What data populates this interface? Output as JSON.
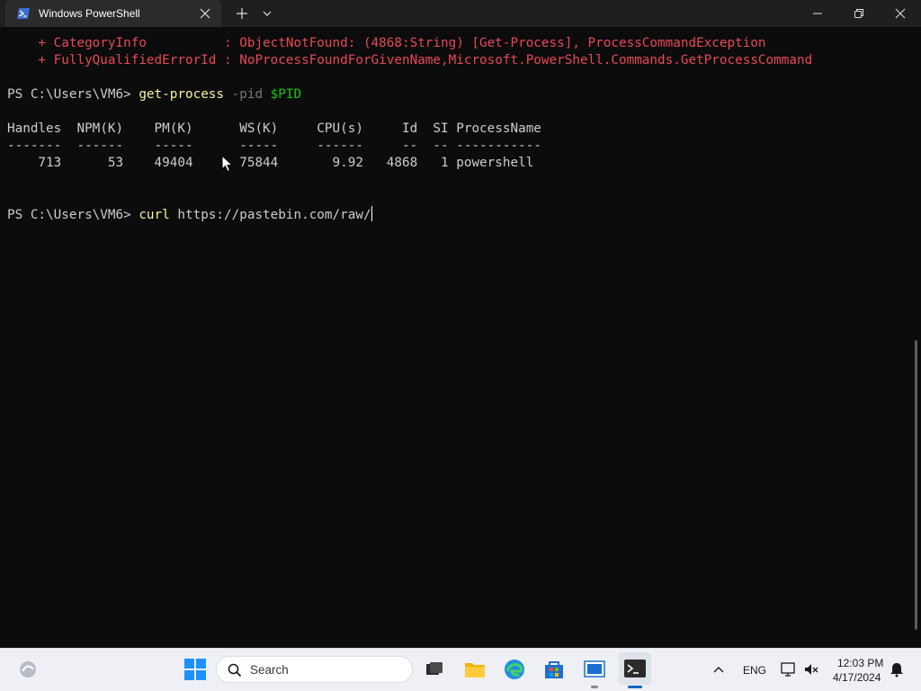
{
  "window": {
    "tab_title": "Windows PowerShell",
    "tab_icon": "powershell-icon"
  },
  "terminal": {
    "error_line_1": "    + CategoryInfo          : ObjectNotFound: (4868:String) [Get-Process], ProcessCommandException",
    "error_line_2": "    + FullyQualifiedErrorId : NoProcessFoundForGivenName,Microsoft.PowerShell.Commands.GetProcessCommand",
    "prompt_1": "PS C:\\Users\\VM6> ",
    "command_1": {
      "cmdlet": "get-process",
      "param": "-pid",
      "variable": "$PID"
    },
    "table": {
      "header": "Handles  NPM(K)    PM(K)      WS(K)     CPU(s)     Id  SI ProcessName",
      "separator": "-------  ------    -----      -----     ------     --  -- -----------",
      "row": "    713      53    49404      75844       9.92   4868   1 powershell",
      "columns": [
        "Handles",
        "NPM(K)",
        "PM(K)",
        "WS(K)",
        "CPU(s)",
        "Id",
        "SI",
        "ProcessName"
      ],
      "rows": [
        [
          "713",
          "53",
          "49404",
          "75844",
          "9.92",
          "4868",
          "1",
          "powershell"
        ]
      ]
    },
    "prompt_2": "PS C:\\Users\\VM6> ",
    "command_2": {
      "cmdlet": "curl",
      "argument": "https://pastebin.com/raw/"
    }
  },
  "taskbar": {
    "search_placeholder": "Search",
    "pinned": [
      "start-icon",
      "search-icon",
      "task-view-icon",
      "file-explorer-icon",
      "edge-icon",
      "microsoft-store-icon",
      "app-icon",
      "terminal-icon"
    ],
    "language": "ENG",
    "time": "12:03 PM",
    "date": "4/17/2024"
  },
  "colors": {
    "terminal_bg": "#0c0c0c",
    "error": "#e74856",
    "cmdlet": "#f9f1a5",
    "parameter": "#767676",
    "variable": "#16c60c",
    "accent": "#0067c0"
  }
}
